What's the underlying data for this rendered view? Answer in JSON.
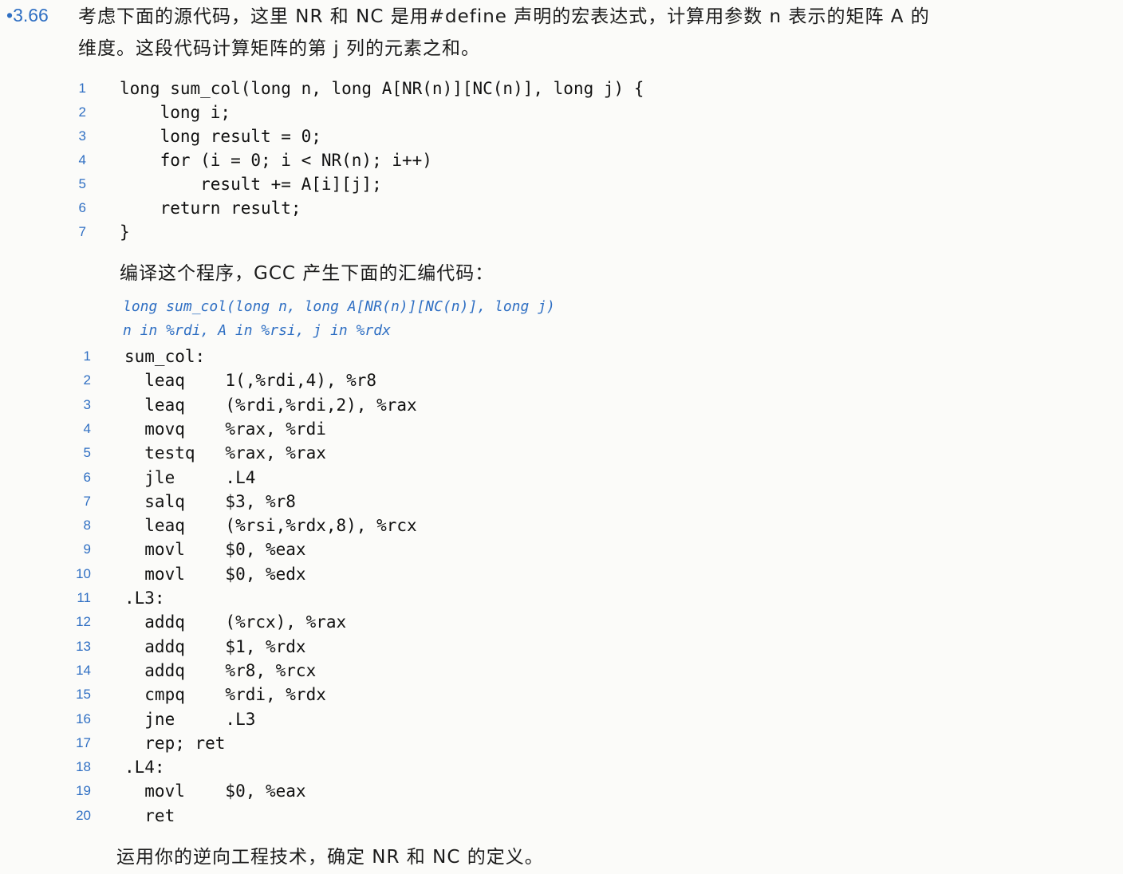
{
  "problem": {
    "number": "3.66",
    "intro_line1": "考虑下面的源代码，这里 NR 和 NC 是用#define 声明的宏表达式，计算用参数 n 表示的矩阵 A 的",
    "intro_line2": "维度。这段代码计算矩阵的第 j 列的元素之和。"
  },
  "c_code": [
    {
      "n": "1",
      "text": "long sum_col(long n, long A[NR(n)][NC(n)], long j) {"
    },
    {
      "n": "2",
      "text": "    long i;"
    },
    {
      "n": "3",
      "text": "    long result = 0;"
    },
    {
      "n": "4",
      "text": "    for (i = 0; i < NR(n); i++)"
    },
    {
      "n": "5",
      "text": "        result += A[i][j];"
    },
    {
      "n": "6",
      "text": "    return result;"
    },
    {
      "n": "7",
      "text": "}"
    }
  ],
  "compile_text": "编译这个程序，GCC 产生下面的汇编代码：",
  "annotation": {
    "line1": "long sum_col(long n, long A[NR(n)][NC(n)], long j)",
    "line2": "n in %rdi, A in %rsi, j in %rdx"
  },
  "asm_code": [
    {
      "n": "1",
      "text": "sum_col:"
    },
    {
      "n": "2",
      "text": "  leaq    1(,%rdi,4), %r8"
    },
    {
      "n": "3",
      "text": "  leaq    (%rdi,%rdi,2), %rax"
    },
    {
      "n": "4",
      "text": "  movq    %rax, %rdi"
    },
    {
      "n": "5",
      "text": "  testq   %rax, %rax"
    },
    {
      "n": "6",
      "text": "  jle     .L4"
    },
    {
      "n": "7",
      "text": "  salq    $3, %r8"
    },
    {
      "n": "8",
      "text": "  leaq    (%rsi,%rdx,8), %rcx"
    },
    {
      "n": "9",
      "text": "  movl    $0, %eax"
    },
    {
      "n": "10",
      "text": "  movl    $0, %edx"
    },
    {
      "n": "11",
      "text": ".L3:"
    },
    {
      "n": "12",
      "text": "  addq    (%rcx), %rax"
    },
    {
      "n": "13",
      "text": "  addq    $1, %rdx"
    },
    {
      "n": "14",
      "text": "  addq    %r8, %rcx"
    },
    {
      "n": "15",
      "text": "  cmpq    %rdi, %rdx"
    },
    {
      "n": "16",
      "text": "  jne     .L3"
    },
    {
      "n": "17",
      "text": "  rep; ret"
    },
    {
      "n": "18",
      "text": ".L4:"
    },
    {
      "n": "19",
      "text": "  movl    $0, %eax"
    },
    {
      "n": "20",
      "text": "  ret"
    }
  ],
  "closing_text": "运用你的逆向工程技术，确定 NR 和 NC 的定义。",
  "colors": {
    "accent": "#2f6fc3",
    "text": "#1b1b1b",
    "background": "#fbfbf9"
  }
}
